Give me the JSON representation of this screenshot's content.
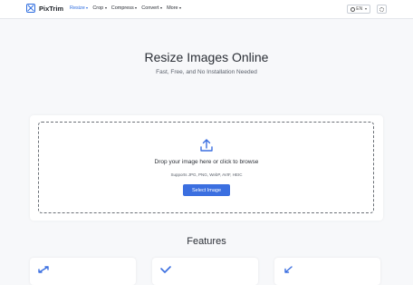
{
  "nav": {
    "brand": "PixTrim",
    "menu": [
      {
        "label": "Resize",
        "active": true
      },
      {
        "label": "Crop",
        "active": false
      },
      {
        "label": "Compress",
        "active": false
      },
      {
        "label": "Convert",
        "active": false
      },
      {
        "label": "More",
        "active": false
      }
    ],
    "language": "EN",
    "settings_icon": "gear-icon"
  },
  "hero": {
    "title": "Resize Images Online",
    "subtitle": "Fast, Free, and No Installation Needed"
  },
  "upload": {
    "icon": "upload-icon",
    "prompt": "Drop your image here or click to browse",
    "supports": "Supports JPG, PNG, WebP, AVIF, HEIC",
    "button": "Select Image"
  },
  "features": {
    "title": "Features",
    "cards": [
      {
        "icon": "resize-arrows-icon"
      },
      {
        "icon": "check-icon"
      },
      {
        "icon": "shrink-arrow-icon"
      }
    ]
  },
  "colors": {
    "accent": "#3b6fe0",
    "background": "#f7f8fa"
  }
}
